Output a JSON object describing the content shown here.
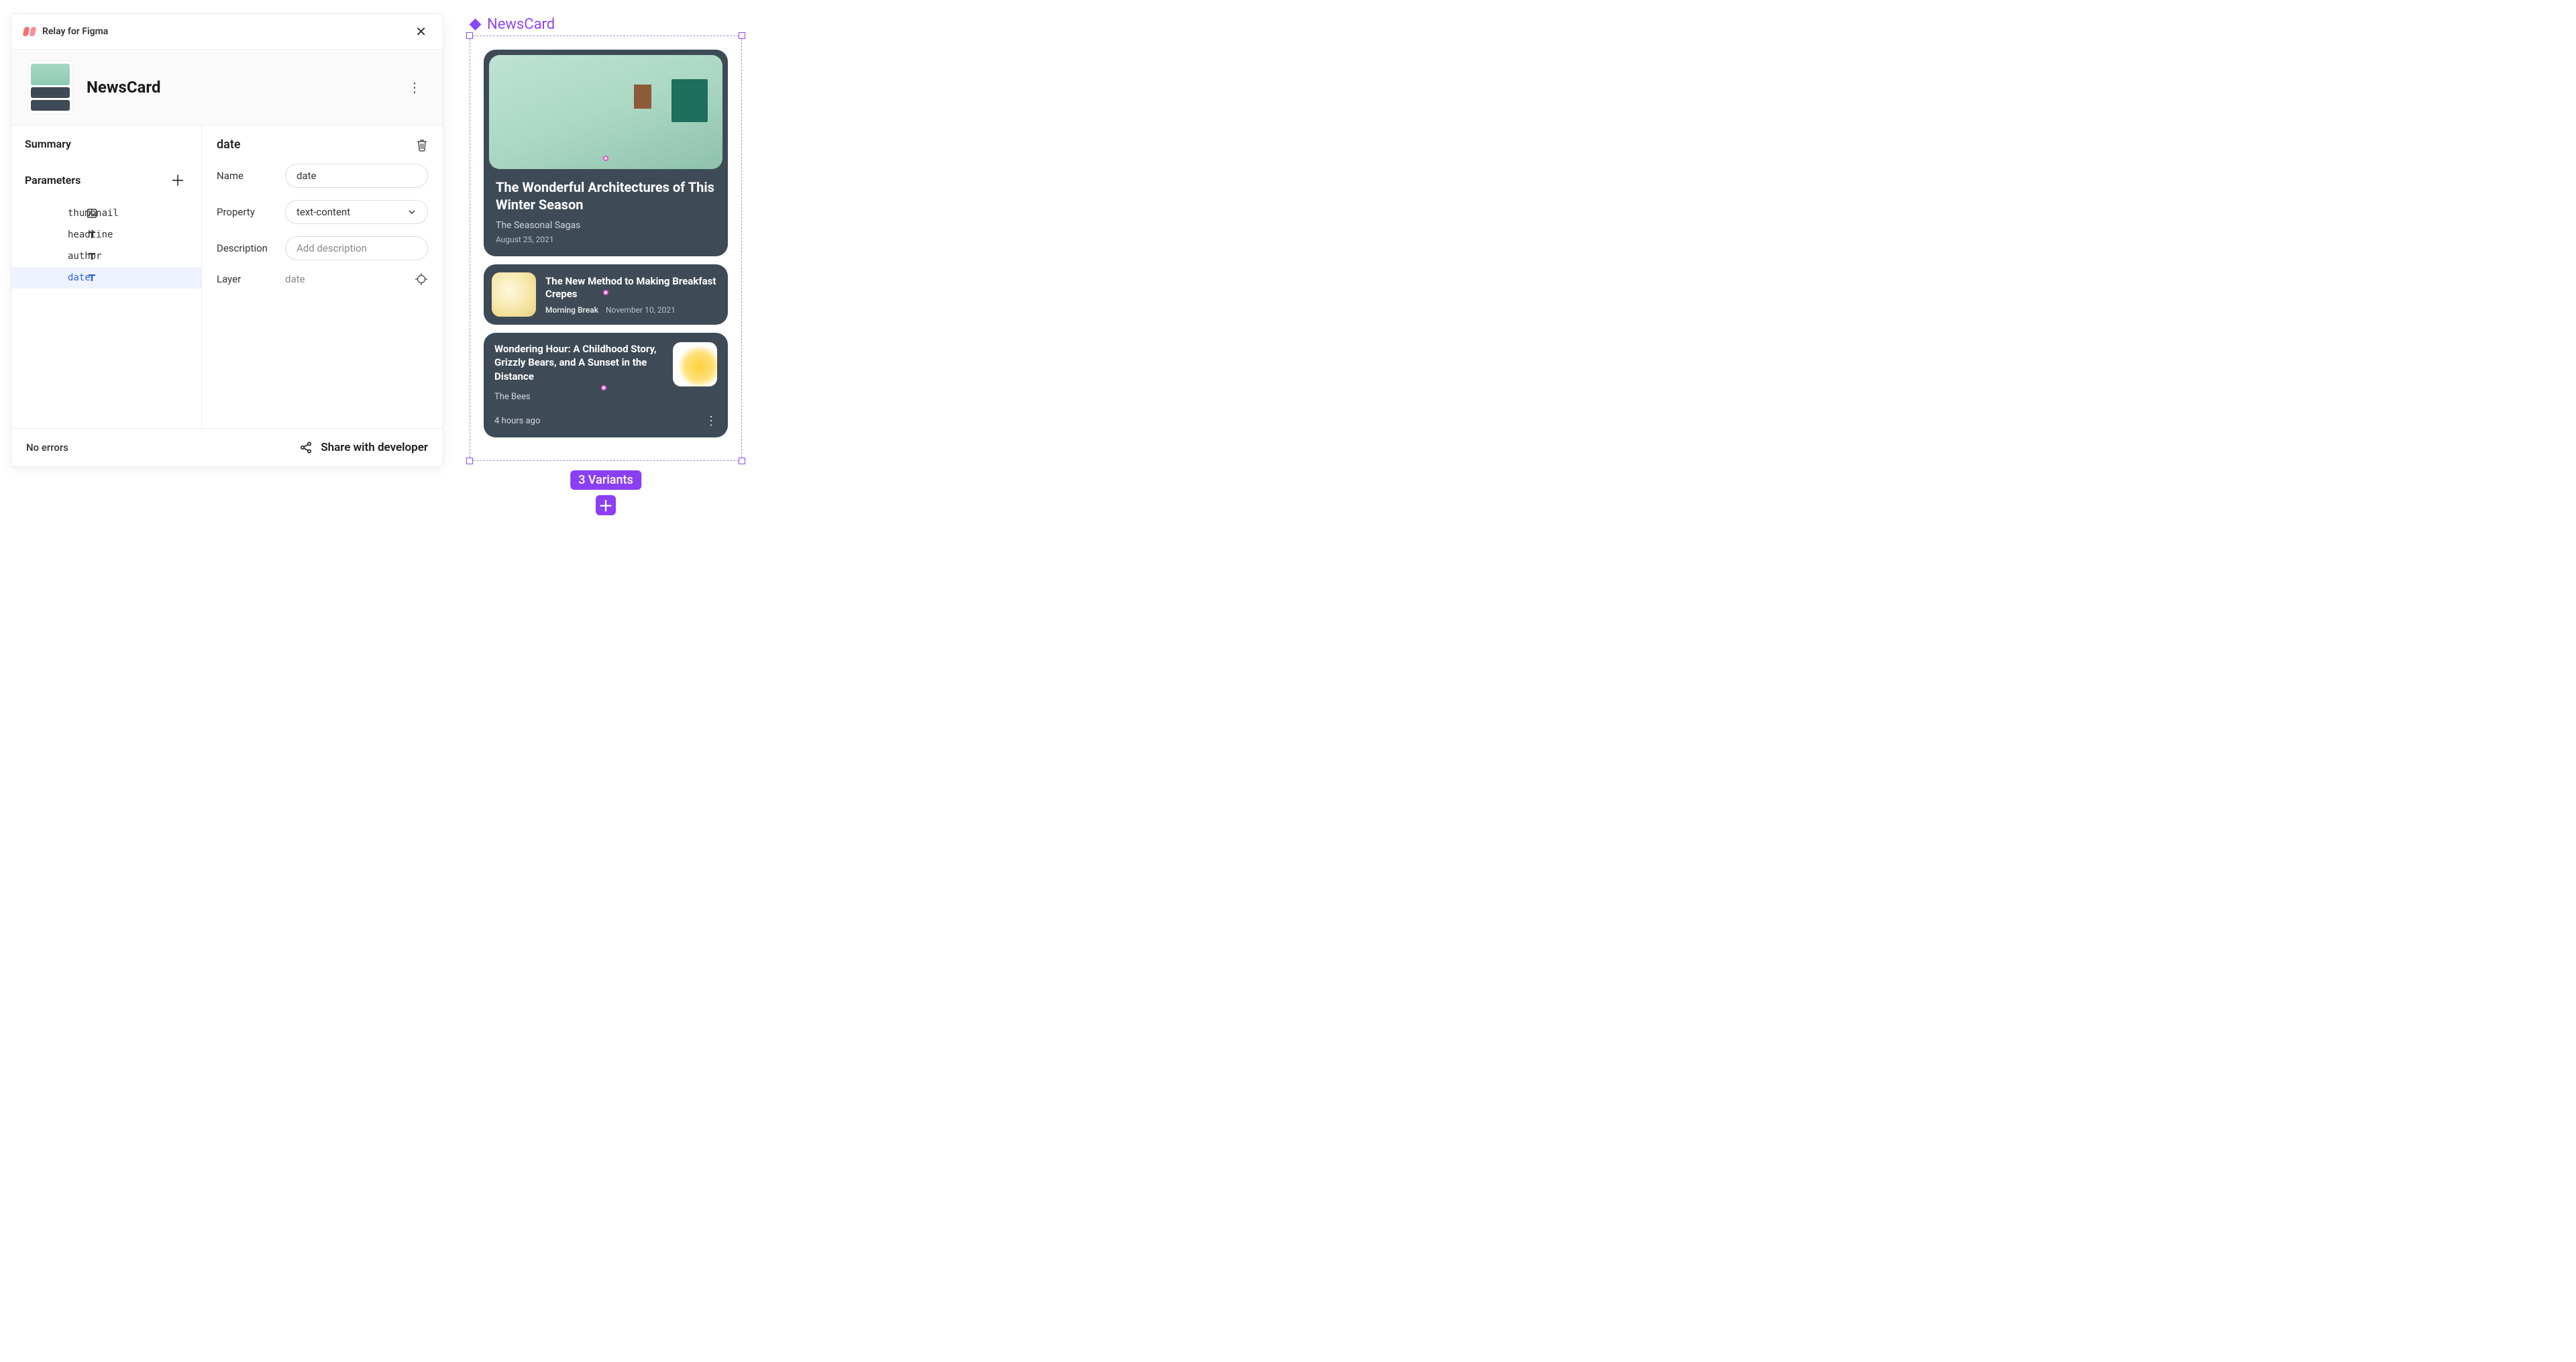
{
  "plugin": {
    "title": "Relay for Figma",
    "component_name": "NewsCard",
    "sidebar": {
      "summary_label": "Summary",
      "parameters_label": "Parameters",
      "params": [
        {
          "icon": "image",
          "name": "thumbnail"
        },
        {
          "icon": "text",
          "name": "headline"
        },
        {
          "icon": "text",
          "name": "author"
        },
        {
          "icon": "text",
          "name": "date"
        }
      ],
      "selected_param": "date"
    },
    "detail": {
      "title": "date",
      "name_label": "Name",
      "name_value": "date",
      "property_label": "Property",
      "property_value": "text-content",
      "description_label": "Description",
      "description_placeholder": "Add description",
      "layer_label": "Layer",
      "layer_value": "date"
    },
    "footer": {
      "status": "No errors",
      "share_label": "Share with developer"
    }
  },
  "canvas": {
    "component_label": "NewsCard",
    "variants_badge": "3 Variants",
    "cards": [
      {
        "headline": "The Wonderful Architectures of This Winter Season",
        "author": "The Seasonal Sagas",
        "date": "August 25, 2021"
      },
      {
        "headline": "The New Method to Making Breakfast Crepes",
        "author": "Morning Break",
        "date": "November 10, 2021"
      },
      {
        "headline": "Wondering Hour: A Childhood Story, Grizzly Bears, and A Sunset in the Distance",
        "author": "The Bees",
        "date": "4 hours ago"
      }
    ]
  }
}
